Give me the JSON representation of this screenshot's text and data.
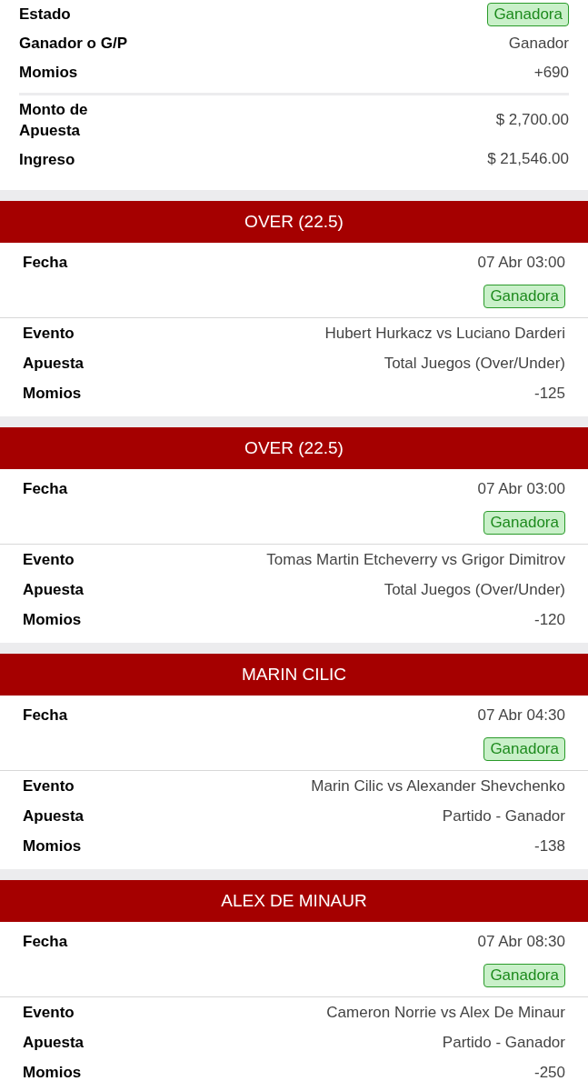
{
  "summary": {
    "rows": [
      {
        "label": "Estado",
        "kind": "badge",
        "value": "Ganadora"
      },
      {
        "label": "Ganador o G/P",
        "kind": "text",
        "value": "Ganador"
      },
      {
        "label": "Momios",
        "kind": "text",
        "value": "+690"
      }
    ],
    "totals": [
      {
        "label": "Monto de Apuesta",
        "value": "$ 2,700.00"
      },
      {
        "label": "Ingreso",
        "value": "$ 21,546.00"
      }
    ]
  },
  "bets": [
    {
      "title": "OVER (22.5)",
      "date_label": "Fecha",
      "date": "07 Abr 03:00",
      "status_text": "Ganadora",
      "rows": [
        {
          "label": "Evento",
          "value": "Hubert Hurkacz vs Luciano Darderi"
        },
        {
          "label": "Apuesta",
          "value": "Total Juegos (Over/Under)"
        },
        {
          "label": "Momios",
          "value": "-125"
        }
      ]
    },
    {
      "title": "OVER (22.5)",
      "date_label": "Fecha",
      "date": "07 Abr 03:00",
      "status_text": "Ganadora",
      "rows": [
        {
          "label": "Evento",
          "value": "Tomas Martin Etcheverry vs Grigor Dimitrov"
        },
        {
          "label": "Apuesta",
          "value": "Total Juegos (Over/Under)"
        },
        {
          "label": "Momios",
          "value": "-120"
        }
      ]
    },
    {
      "title": "MARIN CILIC",
      "date_label": "Fecha",
      "date": "07 Abr 04:30",
      "status_text": "Ganadora",
      "rows": [
        {
          "label": "Evento",
          "value": "Marin Cilic vs Alexander Shevchenko"
        },
        {
          "label": "Apuesta",
          "value": "Partido - Ganador"
        },
        {
          "label": "Momios",
          "value": "-138"
        }
      ]
    },
    {
      "title": "ALEX DE MINAUR",
      "date_label": "Fecha",
      "date": "07 Abr 08:30",
      "status_text": "Ganadora",
      "rows": [
        {
          "label": "Evento",
          "value": "Cameron Norrie vs Alex De Minaur"
        },
        {
          "label": "Apuesta",
          "value": "Partido - Ganador"
        },
        {
          "label": "Momios",
          "value": "-250"
        }
      ]
    }
  ]
}
